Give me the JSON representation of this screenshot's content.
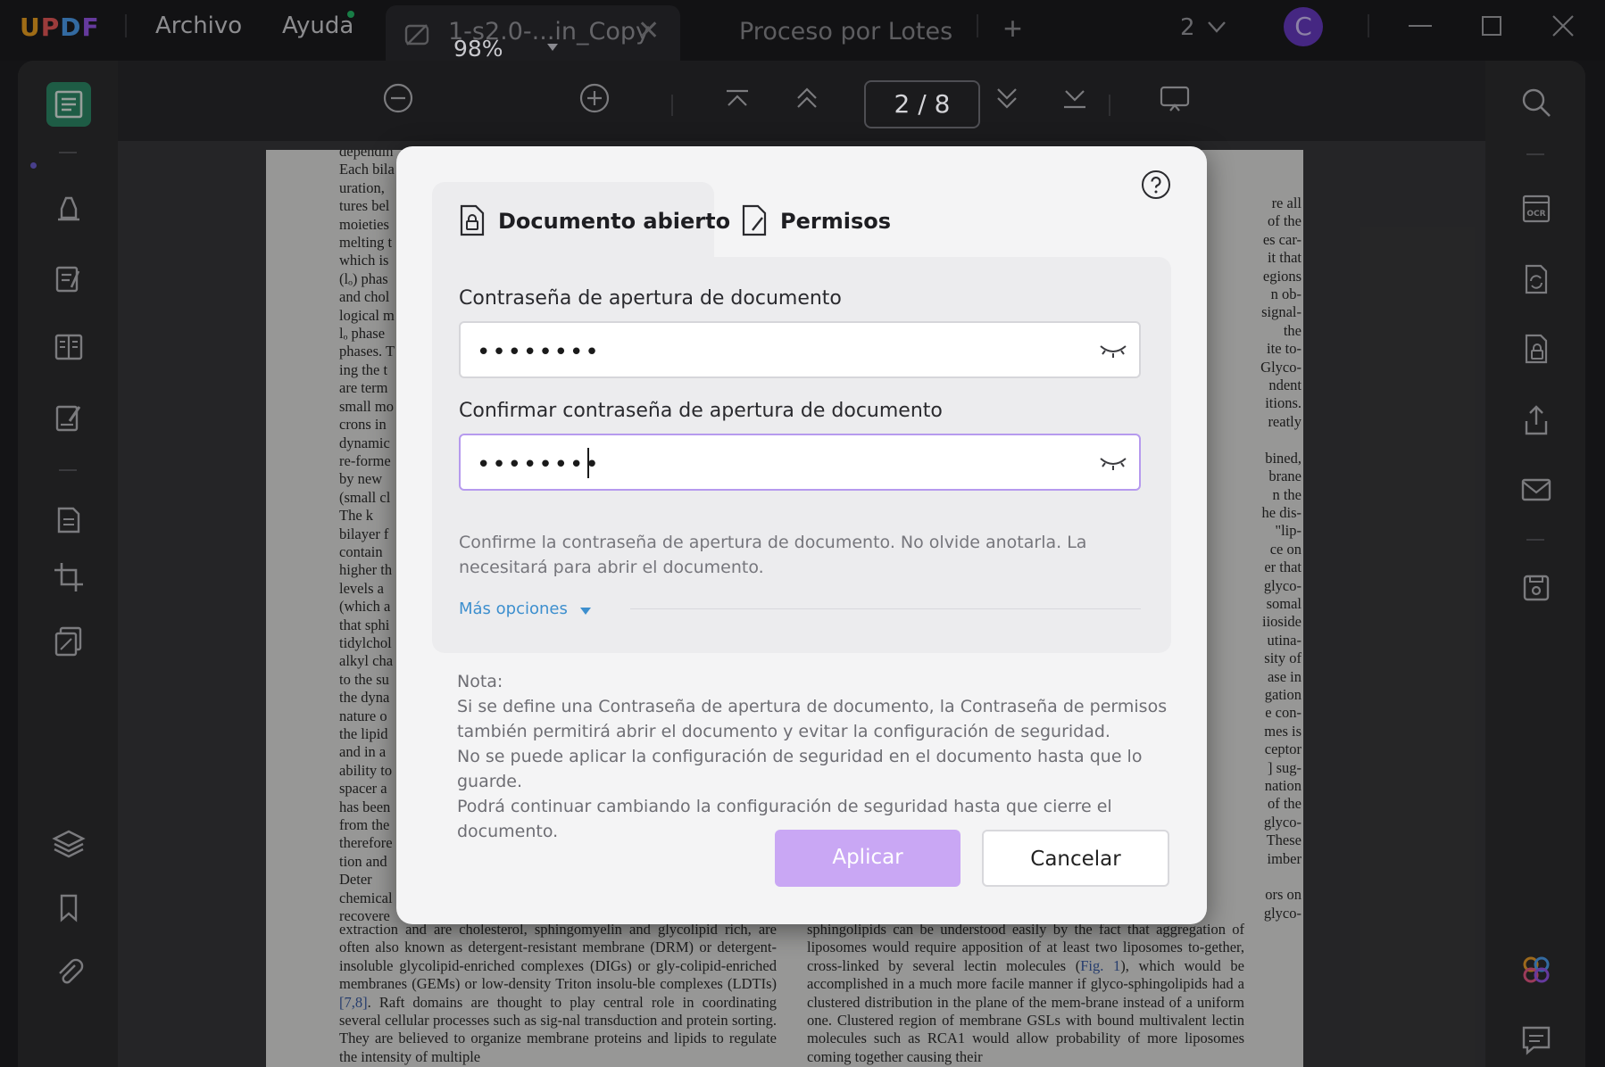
{
  "app": {
    "logo": "UPDF"
  },
  "menu": {
    "file": "Archivo",
    "help": "Ayuda"
  },
  "tabs": {
    "active_title": "1-s2.0-...in_Copy",
    "close": "✕",
    "batch": "Proceso por Lotes",
    "add": "+"
  },
  "window": {
    "count": "2",
    "avatar_letter": "C"
  },
  "toolbar": {
    "zoom": "98%",
    "page_current": "2",
    "page_sep": "/",
    "page_total": "8"
  },
  "document": {
    "left_lines": [
      "dependin",
      "Each bila",
      "uration,",
      "tures bel",
      "moieties",
      "melting t",
      "which is",
      "(lₒ) phas",
      "and chol",
      "logical m",
      "lₒ phase",
      "phases. T",
      "ing the t",
      "are term",
      "small mo",
      "crons in",
      "dynamic",
      "re-forme",
      "by new",
      "(small cl",
      "   The k",
      "bilayer f",
      "contain",
      "higher th",
      "levels a",
      "(which a",
      "that sphi",
      "tidylchol",
      "alkyl cha",
      "to the su",
      "the dyna",
      "nature o",
      "the lipid",
      "and in a",
      "ability to",
      "spacer a",
      "has been",
      "from the",
      "therefore",
      "tion and",
      "   Deter",
      "chemical",
      "recovere"
    ],
    "right_lines": [
      "re all",
      "of the",
      "es car-",
      "it that",
      "egions",
      "n ob-",
      "signal-",
      "the",
      "ite to-",
      "Glyco-",
      "ndent",
      "itions.",
      "reatly",
      "",
      "bined,",
      "brane",
      "n the",
      "he dis-",
      "\"lip-",
      "ce on",
      "er that",
      "glyco-",
      "somal",
      "iioside",
      "utina-",
      "sity of",
      "ase in",
      "gation",
      "e con-",
      "mes is",
      "ceptor",
      "] sug-",
      "nation",
      "of the",
      "glyco-",
      "These",
      "imber",
      "",
      "ors on",
      "glyco-"
    ],
    "bottom_left": "extraction and are cholesterol, sphingomyelin and glycolipid rich, are often also known as detergent-resistant membrane (DRM) or detergent-insoluble glycolipid-enriched complexes (DIGs) or gly-colipid-enriched membranes (GEMs) or low-density Triton insolu-ble complexes (LDTIs)",
    "bottom_left_ref": "[7,8]",
    "bottom_left_2": ". Raft domains are thought to play central role in coordinating several cellular processes such as sig-nal transduction and protein sorting. They are believed to organize membrane proteins and lipids to regulate the intensity of multiple",
    "bottom_right": "sphingolipids can be understood easily by the fact that aggregation of liposomes would require apposition of at least two liposomes to-gether, cross-linked by several lectin molecules (",
    "bottom_right_ref": "Fig. 1",
    "bottom_right_2": "), which would be accomplished in a much more facile manner if glyco-sphingolipids had a clustered distribution in the plane of the mem-brane instead of a uniform one. Clustered region of membrane GSLs with bound multivalent lectin molecules such as RCA1 would allow probability of more liposomes coming together causing their"
  },
  "dialog": {
    "tab_open": "Documento abierto",
    "tab_permissions": "Permisos",
    "open_pw_label": "Contraseña de apertura de documento",
    "open_pw_value": "••••••••",
    "confirm_pw_label": "Confirmar contraseña de apertura de documento",
    "confirm_pw_value": "••••••••",
    "hint": "Confirme la contraseña de apertura de documento. No olvide anotarla. La necesitará para abrir el documento.",
    "more_options": "Más opciones",
    "note_title": "Nota:",
    "note_lines": [
      "Si se define una Contraseña de apertura de documento, la Contraseña de permisos",
      "también permitirá abrir el documento  y evitar la configuración de seguridad.",
      "No se puede aplicar la configuración de seguridad en el documento hasta que lo guarde.",
      "Podrá continuar cambiando la configuración de seguridad hasta que cierre el documento."
    ],
    "apply": "Aplicar",
    "cancel": "Cancelar"
  },
  "colors": {
    "accent_purple": "#c9a7f4",
    "active_tool_green": "#2f8e6a",
    "link_blue": "#3d8fce",
    "avatar_purple": "#6a3cc8"
  },
  "icons": {
    "left_sidebar": [
      "reader-icon",
      "comment-icon",
      "edit-text-icon",
      "page-organize-icon",
      "fill-sign-icon",
      "convert-icon",
      "crop-icon",
      "batch-icon",
      "layers-icon",
      "bookmark-icon",
      "attachment-icon"
    ],
    "right_sidebar": [
      "search-icon",
      "ocr-icon",
      "convert-pdf-icon",
      "protect-icon",
      "share-icon",
      "email-icon",
      "save-icon",
      "ai-assistant-icon",
      "chat-icon"
    ],
    "toolbar": [
      "zoom-out-icon",
      "zoom-dropdown-icon",
      "zoom-in-icon",
      "first-page-icon",
      "prev-page-icon",
      "next-page-icon",
      "last-page-icon",
      "presentation-icon"
    ]
  }
}
